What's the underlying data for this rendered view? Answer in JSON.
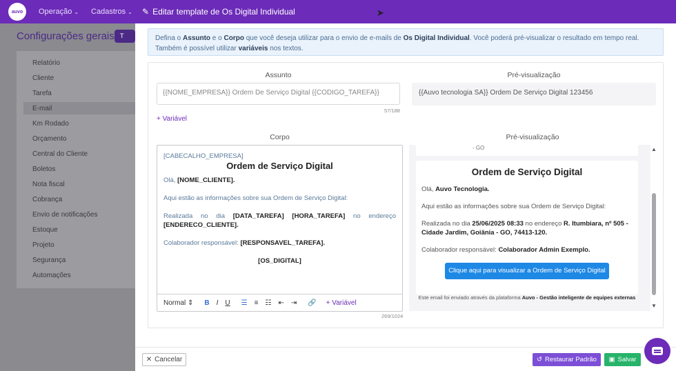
{
  "background": {
    "logo_text": "auvo",
    "menu": [
      {
        "label": "Operação"
      },
      {
        "label": "Cadastros"
      }
    ],
    "page_title": "Configurações gerais",
    "video_badge": "T",
    "sidebar": [
      "Relatório",
      "Cliente",
      "Tarefa",
      "E-mail",
      "Km Rodado",
      "Orçamento",
      "Central do Cliente",
      "Boletos",
      "Nota fiscal",
      "Cobrança",
      "Envio de notificações",
      "Estoque",
      "Projeto",
      "Segurança",
      "Automações"
    ]
  },
  "modal": {
    "title": "Editar template de Os Digital Individual",
    "info": {
      "p1": "Defina o ",
      "b1": "Assunto",
      "p2": " e o ",
      "b2": "Corpo",
      "p3": " que você deseja utilizar para o envio de e-mails de ",
      "b3": "Os Digital Individual",
      "p4": ". Você poderá pré-visualizar o resultado em tempo real. Também é possível utilizar ",
      "b4": "variáveis",
      "p5": " nos textos."
    },
    "subject": {
      "label": "Assunto",
      "value": "{{NOME_EMPRESA}} Ordem De Serviço Digital {{CODIGO_TAREFA}}",
      "counter": "57/188",
      "add_variable": "+ Variável",
      "preview_label": "Pré-visualização",
      "preview_value": "{{Auvo tecnologia SA}} Ordem De Serviço Digital 123456"
    },
    "body": {
      "label": "Corpo",
      "header_var": "[CABECALHO_EMPRESA]",
      "heading": "Ordem de Serviço Digital",
      "greeting": "Olá, ",
      "client_var": "[NOME_CLIENTE].",
      "info_line": "Aqui estão as informações sobre sua Ordem de Serviço Digital:",
      "realized_words": [
        "Realizada",
        "no",
        "dia",
        "[DATA_TAREFA]",
        "[HORA_TAREFA]",
        "no",
        "endereço"
      ],
      "address_var": "[ENDERECO_CLIENTE].",
      "collab_text": "Colaborador responsável: ",
      "collab_var": "[RESPONSAVEL_TAREFA].",
      "os_var": "[OS_DIGITAL]",
      "counter": "269/1024",
      "toolbar": {
        "format": "Normal",
        "add_variable": "+ Variável"
      }
    },
    "preview": {
      "label": "Pré-visualização",
      "top_fragment": "- GO",
      "heading": "Ordem de Serviço Digital",
      "greeting": "Olá, ",
      "client": "Auvo Tecnologia.",
      "info_line": "Aqui estão as informações sobre sua Ordem de Serviço Digital:",
      "realized_text": "Realizada no dia ",
      "date_time": "25/06/2025 08:33",
      "address_text": " no endereço ",
      "address": "R. Itumbiara, nº 505 - Cidade Jardim, Goiânia - GO, 74413-120.",
      "collab_text": "Colaborador responsável: ",
      "collab": "Colaborador Admin Exemplo.",
      "cta": "Clique aqui para visualizar a Ordem de Serviço Digital",
      "footer_text": "Este email foi enviado através da plataforma ",
      "footer_bold": "Auvo - Gestão inteligente de equipes externas"
    },
    "footer": {
      "cancel": "Cancelar",
      "restore": "Restaurar Padrão",
      "save": "Salvar"
    }
  },
  "colors": {
    "brand_purple": "#6c2bb8",
    "cta_blue": "#1e88e5",
    "save_green": "#27b36a",
    "restore_purple": "#7c4fd6"
  }
}
